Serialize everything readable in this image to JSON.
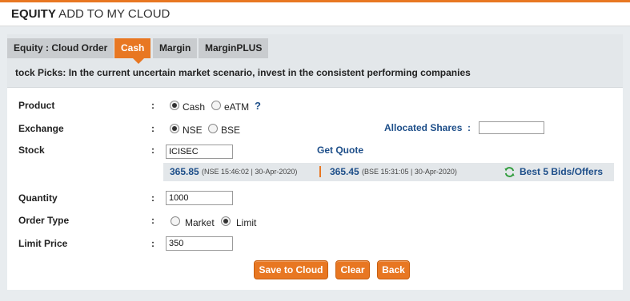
{
  "colors": {
    "accent": "#e87722",
    "link": "#1d4e89"
  },
  "header": {
    "title_bold": "EQUITY",
    "title_rest": " ADD TO MY CLOUD"
  },
  "tabs": [
    {
      "label": "Equity : Cloud Order",
      "active": false
    },
    {
      "label": "Cash",
      "active": true
    },
    {
      "label": "Margin",
      "active": false
    },
    {
      "label": "MarginPLUS",
      "active": false
    }
  ],
  "marquee": "tock Picks: In the current uncertain market scenario, invest in the consistent performing companies",
  "form": {
    "product": {
      "label": "Product",
      "options": [
        "Cash",
        "eATM"
      ],
      "selected": "Cash",
      "help": "?"
    },
    "exchange": {
      "label": "Exchange",
      "options": [
        "NSE",
        "BSE"
      ],
      "selected": "NSE"
    },
    "allocated_shares": {
      "label": "Allocated Shares",
      "value": ""
    },
    "stock": {
      "label": "Stock",
      "value": "ICISEC",
      "get_quote": "Get Quote"
    },
    "quantity": {
      "label": "Quantity",
      "value": "1000"
    },
    "order_type": {
      "label": "Order Type",
      "options": [
        "Market",
        "Limit"
      ],
      "selected": "Limit"
    },
    "limit_price": {
      "label": "Limit Price",
      "value": "350"
    },
    "colon": ":"
  },
  "quote": {
    "nse_price": "365.85",
    "nse_meta": "(NSE 15:46:02 | 30-Apr-2020)",
    "bse_price": "365.45",
    "bse_meta": "(BSE 15:31:05 | 30-Apr-2020)",
    "best_bids": "Best 5 Bids/Offers",
    "refresh_icon": "refresh-icon"
  },
  "buttons": {
    "save": "Save to Cloud",
    "clear": "Clear",
    "back": "Back"
  }
}
